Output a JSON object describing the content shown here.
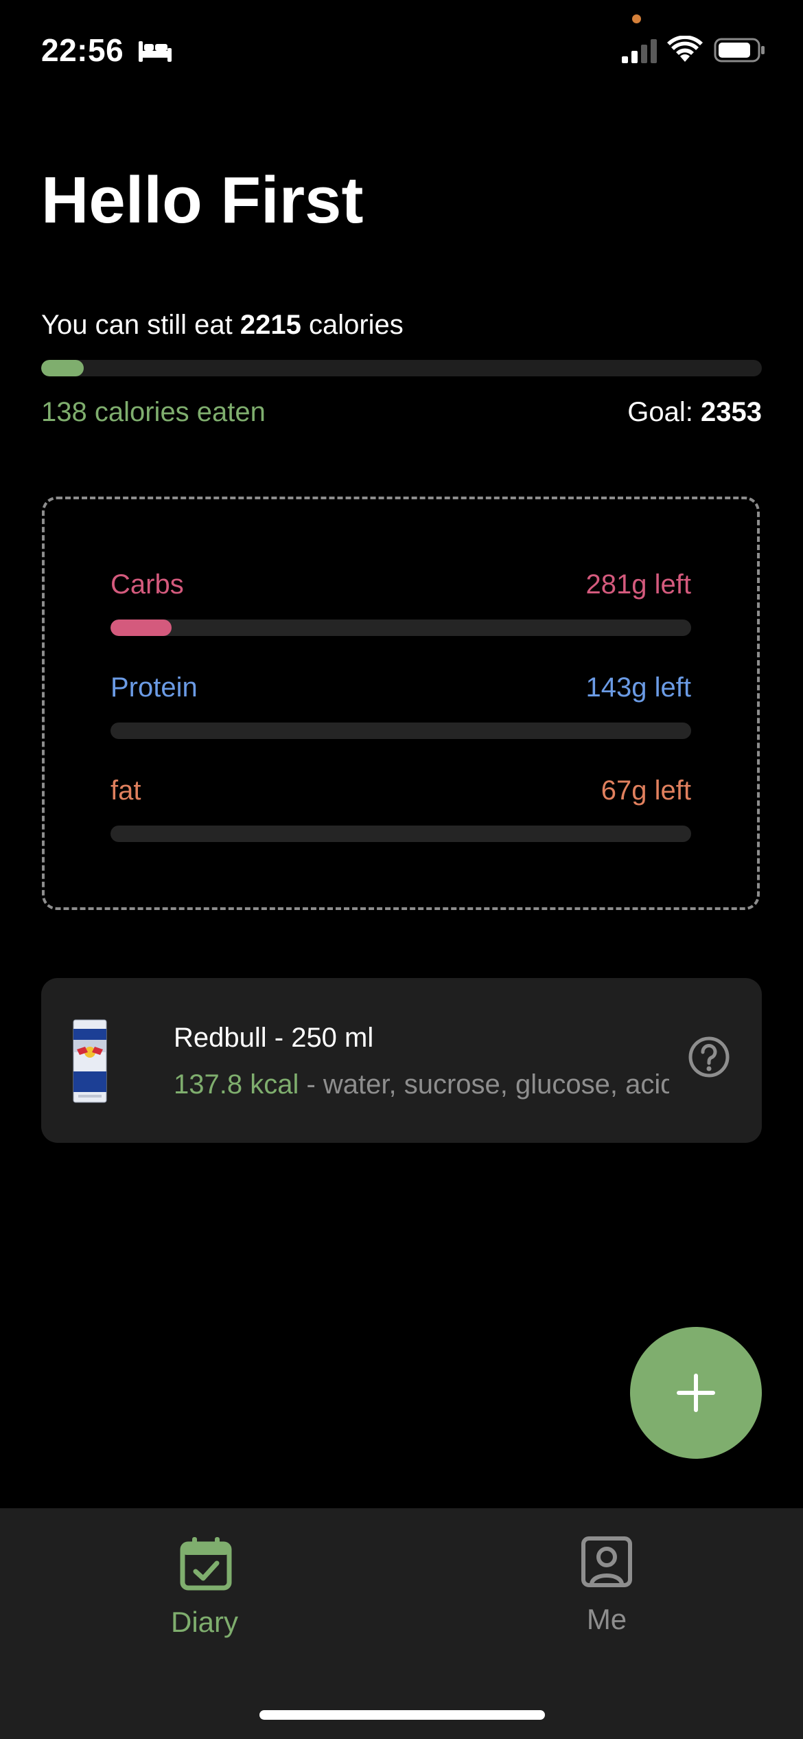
{
  "status_bar": {
    "time": "22:56",
    "icons": [
      "bed-icon",
      "signal-icon",
      "wifi-icon",
      "battery-icon"
    ]
  },
  "greeting": "Hello First",
  "calories": {
    "remaining_prefix": "You can still eat",
    "remaining_value": "2215",
    "remaining_suffix": "calories",
    "eaten_text": "138 calories eaten",
    "goal_label": "Goal:",
    "goal_value": "2353",
    "progress_fraction": 0.059
  },
  "macros": [
    {
      "label": "Carbs",
      "left_text": "281g left",
      "color": "#d45a7d",
      "progress_fraction": 0.105
    },
    {
      "label": "Protein",
      "left_text": "143g left",
      "color": "#6b9be5",
      "progress_fraction": 0
    },
    {
      "label": "fat",
      "left_text": "67g left",
      "color": "#e0805e",
      "progress_fraction": 0
    }
  ],
  "food_entry": {
    "name": "Redbull - 250 ml",
    "kcal": "137.8 kcal",
    "ingredients": " - water, sucrose, glucose, acidity regulators"
  },
  "add_button_label": "+",
  "tabs": [
    {
      "label": "Diary",
      "icon": "calendar-check-icon",
      "active": true
    },
    {
      "label": "Me",
      "icon": "user-square-icon",
      "active": false
    }
  ],
  "colors": {
    "accent": "#7fae6e",
    "background": "#000000",
    "surface": "#1f1f1f"
  }
}
